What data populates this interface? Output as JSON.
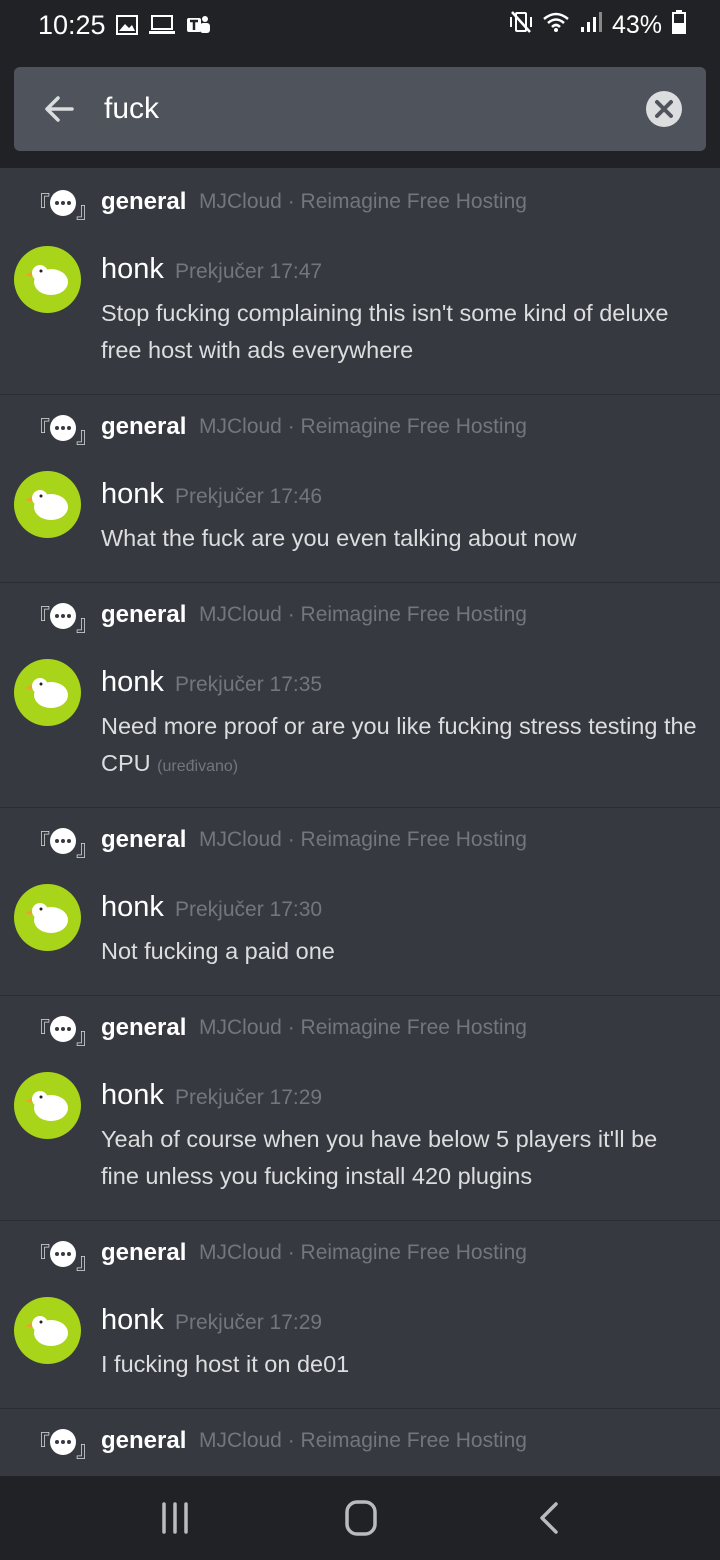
{
  "status_bar": {
    "time": "10:25",
    "left_icons": [
      "image-icon",
      "laptop-icon",
      "teams-icon"
    ],
    "right_icons": [
      "vibrate-mute-icon",
      "wifi-icon",
      "signal-icon"
    ],
    "battery": "43%"
  },
  "search": {
    "query": "fuck",
    "back_icon": "arrow-left-icon",
    "clear_icon": "close-circle-icon"
  },
  "results": [
    {
      "channel": "general",
      "guild": "MJCloud · Reimagine Free Hosting",
      "author": "honk",
      "timestamp": "Prekjučer 17:47",
      "content": "Stop fucking complaining this isn't some kind of deluxe free host with ads everywhere",
      "edited": ""
    },
    {
      "channel": "general",
      "guild": "MJCloud · Reimagine Free Hosting",
      "author": "honk",
      "timestamp": "Prekjučer 17:46",
      "content": "What the fuck are you even talking about now",
      "edited": ""
    },
    {
      "channel": "general",
      "guild": "MJCloud · Reimagine Free Hosting",
      "author": "honk",
      "timestamp": "Prekjučer 17:35",
      "content": "Need more proof or are you like fucking stress testing the CPU",
      "edited": "(uređivano)"
    },
    {
      "channel": "general",
      "guild": "MJCloud · Reimagine Free Hosting",
      "author": "honk",
      "timestamp": "Prekjučer 17:30",
      "content": "Not fucking a paid one",
      "edited": ""
    },
    {
      "channel": "general",
      "guild": "MJCloud · Reimagine Free Hosting",
      "author": "honk",
      "timestamp": "Prekjučer 17:29",
      "content": "Yeah of course when you have below 5 players it'll be fine unless you fucking install 420 plugins",
      "edited": ""
    },
    {
      "channel": "general",
      "guild": "MJCloud · Reimagine Free Hosting",
      "author": "honk",
      "timestamp": "Prekjučer 17:29",
      "content": "I fucking host it on de01",
      "edited": ""
    },
    {
      "channel": "general",
      "guild": "MJCloud · Reimagine Free Hosting",
      "author": "",
      "timestamp": "",
      "content": "",
      "edited": ""
    }
  ],
  "nav_bar": {
    "buttons": [
      "recent-apps-icon",
      "home-icon",
      "back-icon"
    ]
  },
  "colors": {
    "background": "#36393f",
    "bar_background": "#202225",
    "search_field": "#4f545c",
    "avatar_bg": "#a8d419",
    "muted_text": "#72767d"
  }
}
